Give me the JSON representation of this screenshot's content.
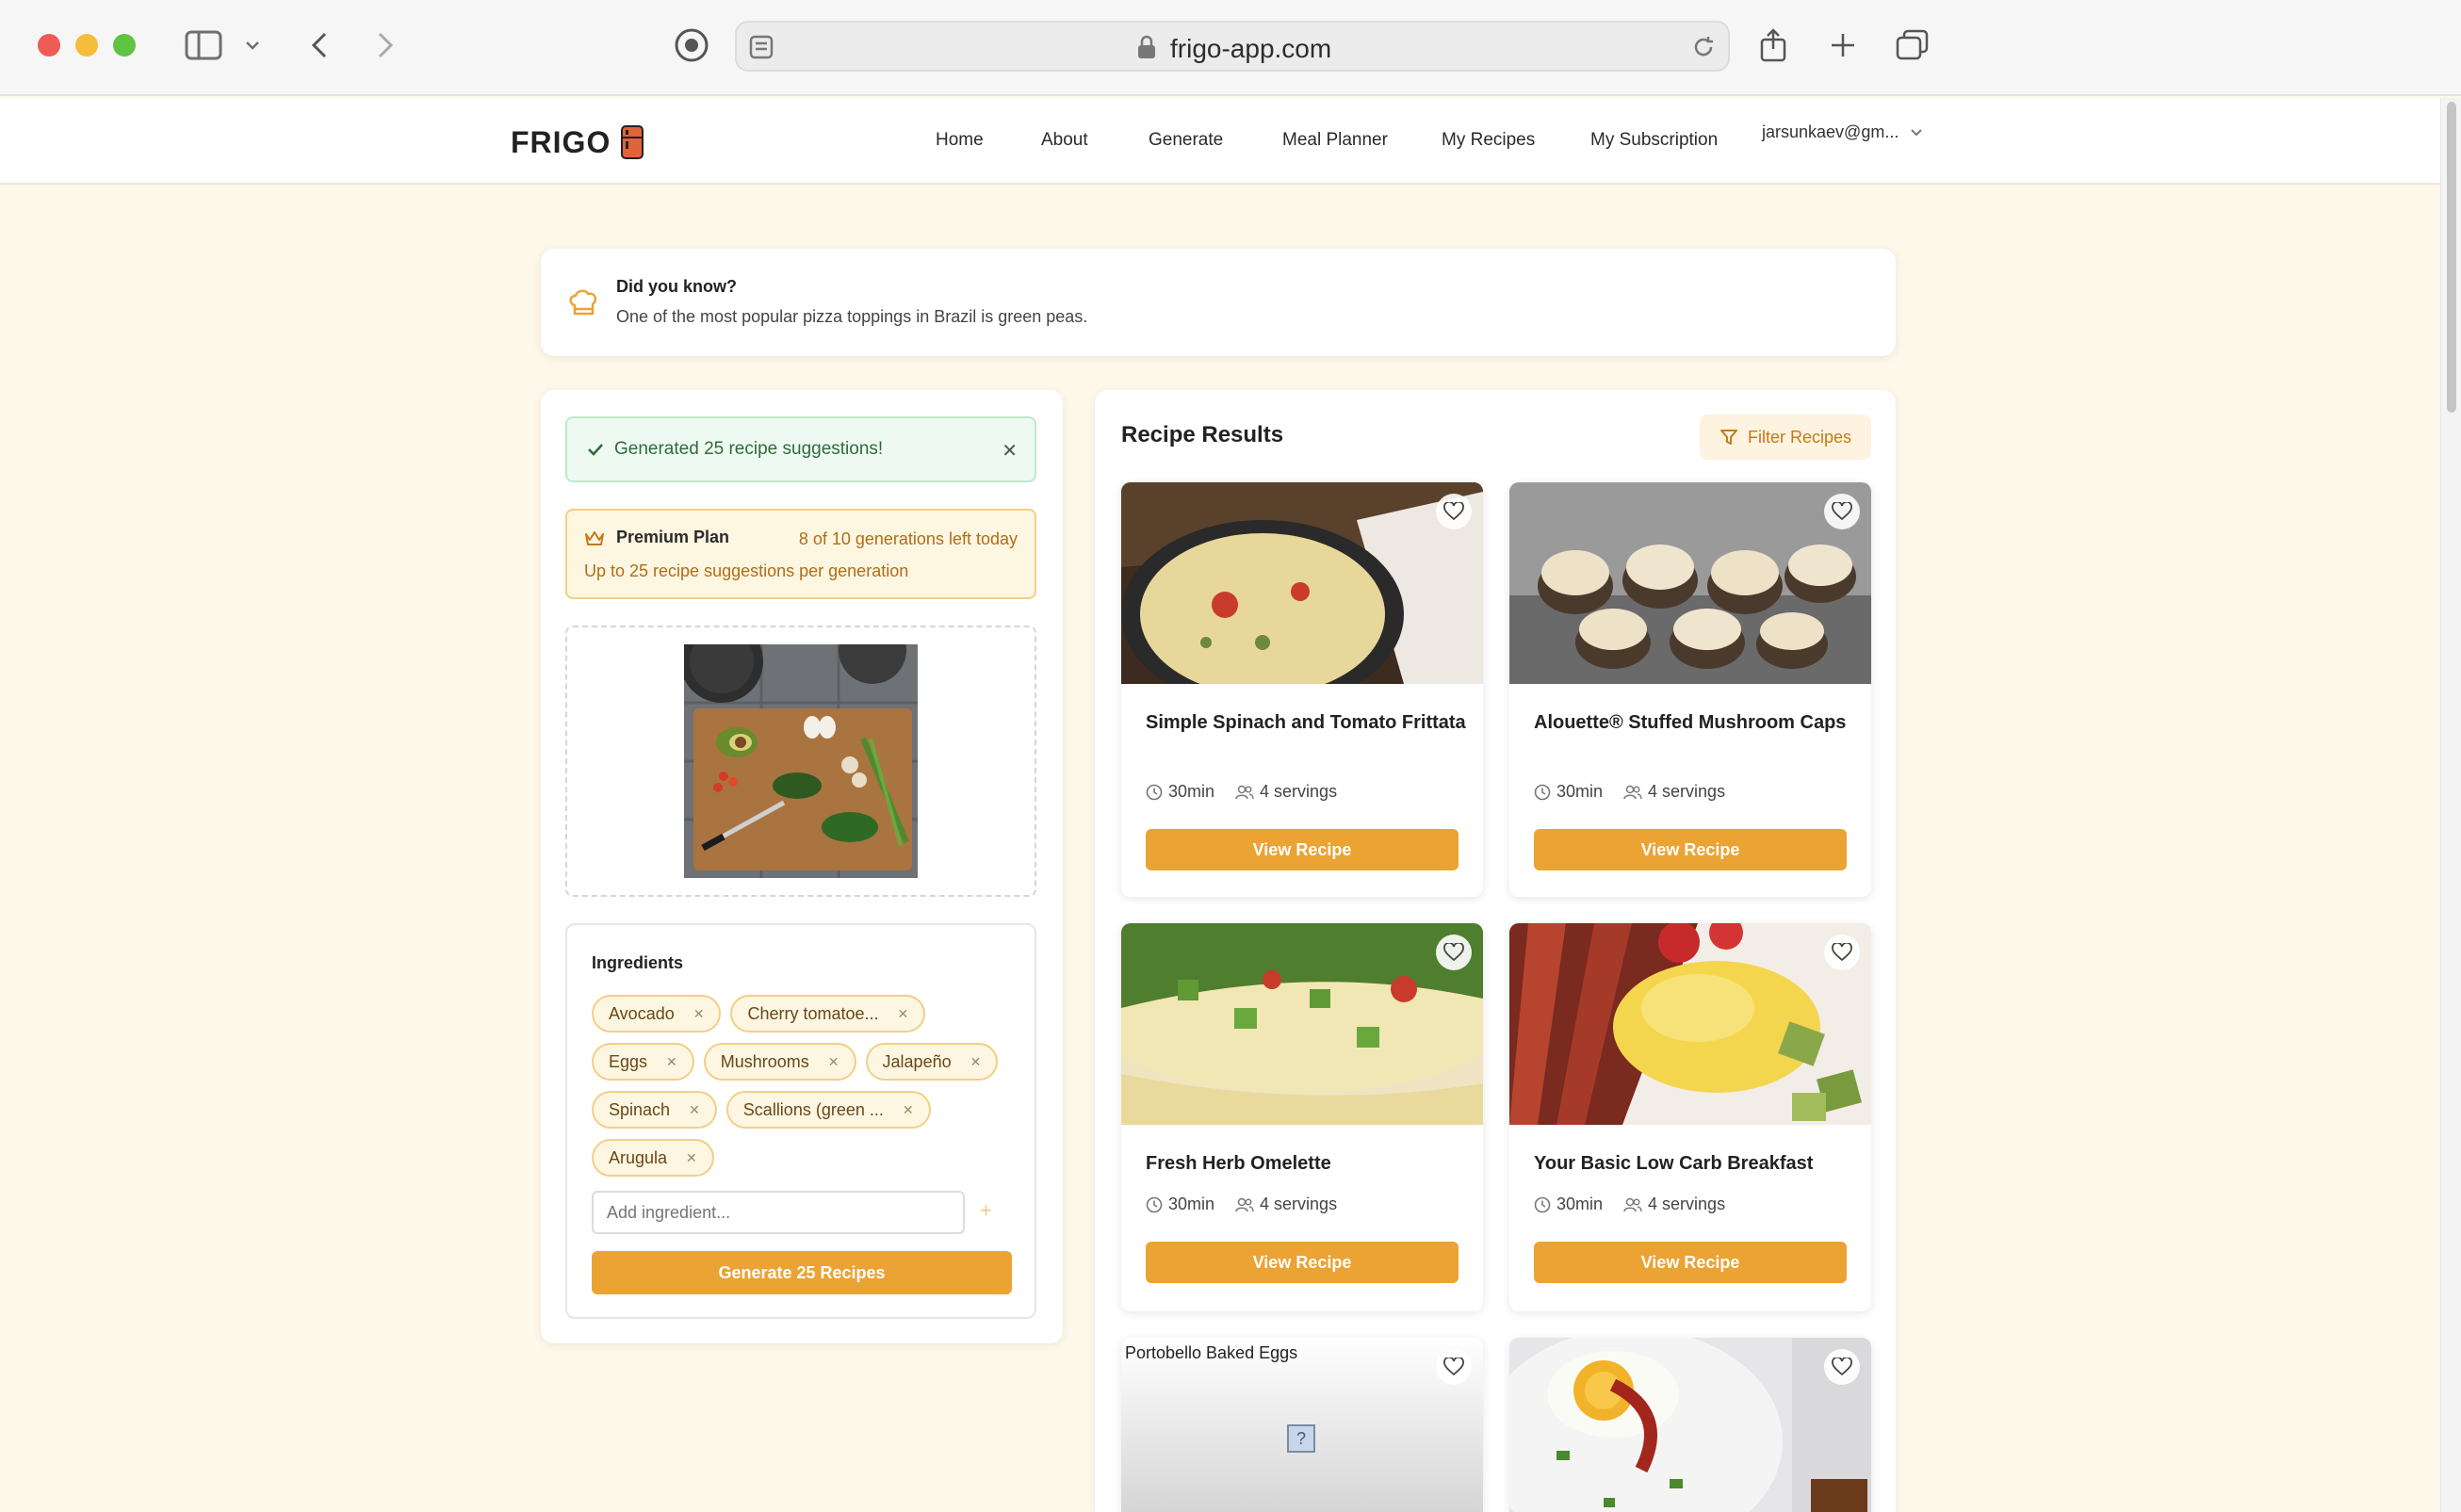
{
  "browser": {
    "url": "frigo-app.com"
  },
  "header": {
    "logo": "FRIGO",
    "nav": [
      "Home",
      "About",
      "Generate",
      "Meal Planner",
      "My Recipes",
      "My Subscription"
    ],
    "user": "jarsunkaev@gm..."
  },
  "tip": {
    "title": "Did you know?",
    "body": "One of the most popular pizza toppings in Brazil is green peas."
  },
  "generator": {
    "success": "Generated 25 recipe suggestions!",
    "plan_name": "Premium Plan",
    "generations_left": "8 of 10 generations left today",
    "plan_note": "Up to 25 recipe suggestions per generation",
    "ingredients_title": "Ingredients",
    "ingredients": [
      "Avocado",
      "Cherry tomatoe...",
      "Eggs",
      "Mushrooms",
      "Jalapeño",
      "Spinach",
      "Scallions (green ...",
      "Arugula"
    ],
    "add_placeholder": "Add ingredient...",
    "generate_label": "Generate 25 Recipes"
  },
  "results": {
    "title": "Recipe Results",
    "filter_label": "Filter Recipes",
    "view_label": "View Recipe",
    "recipes": [
      {
        "title": "Simple Spinach and Tomato Frittata",
        "time": "30min",
        "servings": "4 servings"
      },
      {
        "title": "Alouette® Stuffed Mushroom Caps",
        "time": "30min",
        "servings": "4 servings"
      },
      {
        "title": "Fresh Herb Omelette",
        "time": "30min",
        "servings": "4 servings"
      },
      {
        "title": "Your Basic Low Carb Breakfast",
        "time": "30min",
        "servings": "4 servings"
      },
      {
        "title": "Portobello Baked Eggs"
      }
    ]
  },
  "colors": {
    "accent": "#eba333",
    "page_bg": "#fdf8ea"
  }
}
